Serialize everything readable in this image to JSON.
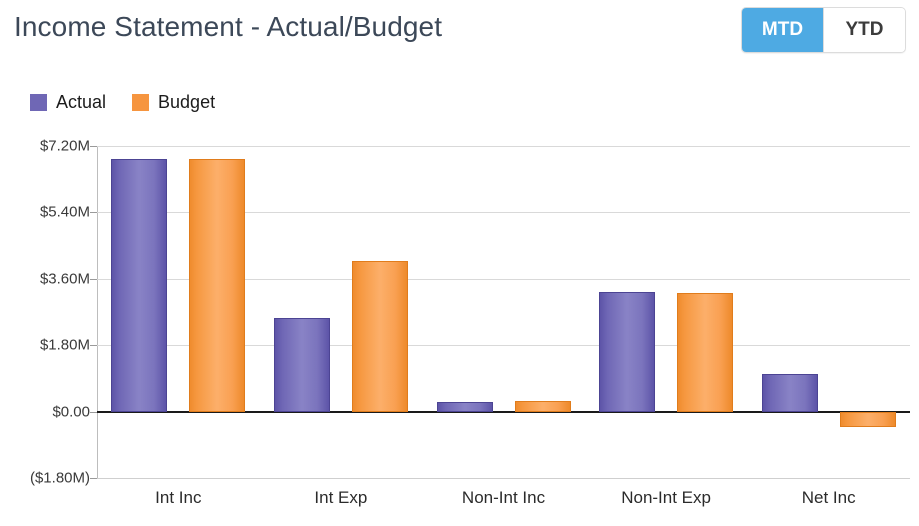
{
  "header": {
    "title": "Income Statement - Actual/Budget",
    "toggle": {
      "options": [
        "MTD",
        "YTD"
      ],
      "selected": "MTD",
      "active_bg": "#4eaae3",
      "active_fg": "#ffffff"
    }
  },
  "chart_data": {
    "type": "bar",
    "title": "Income Statement - Actual/Budget",
    "xlabel": "",
    "ylabel": "",
    "categories": [
      "Int Inc",
      "Int Exp",
      "Non-Int Inc",
      "Non-Int Exp",
      "Net Inc"
    ],
    "series": [
      {
        "name": "Actual",
        "color": "#6f67b5",
        "values": [
          6.84,
          2.54,
          0.27,
          3.25,
          1.03
        ]
      },
      {
        "name": "Budget",
        "color": "#f6953f",
        "values": [
          6.84,
          4.09,
          0.3,
          3.22,
          -0.43
        ]
      }
    ],
    "value_unit": "millions of dollars",
    "ylim": [
      -1.8,
      7.2
    ],
    "yticks": [
      7.2,
      5.4,
      3.6,
      1.8,
      0.0,
      -1.8
    ],
    "ytick_labels": [
      "$7.20M",
      "$5.40M",
      "$3.60M",
      "$1.80M",
      "$0.00",
      "($1.80M)"
    ],
    "grid": true,
    "legend_position": "top-left",
    "zero_line": true
  }
}
